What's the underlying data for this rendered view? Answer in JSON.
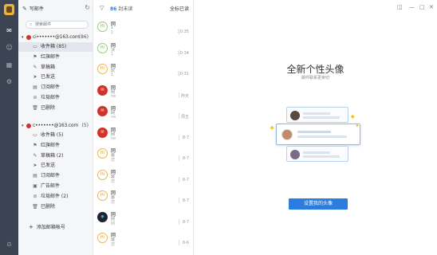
{
  "app": {
    "compose_label": "写邮件",
    "search_placeholder": "搜索邮件"
  },
  "accounts": [
    {
      "name": "ci•••••••@163.com",
      "count": "(86)",
      "folders": [
        {
          "label": "收件箱 (85)",
          "icon": "inbox-icon",
          "glyph": "▭",
          "selected": true
        },
        {
          "label": "红旗邮件",
          "icon": "flag-icon",
          "glyph": "⚑"
        },
        {
          "label": "草稿箱",
          "icon": "draft-icon",
          "glyph": "✎"
        },
        {
          "label": "已发送",
          "icon": "sent-icon",
          "glyph": "➤"
        },
        {
          "label": "订阅邮件",
          "icon": "subscription-icon",
          "glyph": "▤"
        },
        {
          "label": "垃圾邮件",
          "icon": "spam-icon",
          "glyph": "⊘"
        },
        {
          "label": "已删除",
          "icon": "trash-icon",
          "glyph": "🗑"
        }
      ]
    },
    {
      "name": "c•••••••@163.com",
      "count": "(5)",
      "folders": [
        {
          "label": "收件箱 (5)",
          "icon": "inbox-icon",
          "glyph": "▭"
        },
        {
          "label": "红旗邮件",
          "icon": "flag-icon",
          "glyph": "⚑"
        },
        {
          "label": "草稿箱 (2)",
          "icon": "draft-icon",
          "glyph": "✎"
        },
        {
          "label": "已发送",
          "icon": "sent-icon",
          "glyph": "➤"
        },
        {
          "label": "订阅邮件",
          "icon": "subscription-icon",
          "glyph": "▤"
        },
        {
          "label": "广告邮件",
          "icon": "ad-icon",
          "glyph": "▣"
        },
        {
          "label": "垃圾邮件 (2)",
          "icon": "spam-icon",
          "glyph": "⊘"
        },
        {
          "label": "已删除",
          "icon": "trash-icon",
          "glyph": "🗑"
        }
      ]
    }
  ],
  "add_account_label": "添加邮箱帐号",
  "list": {
    "unread_count": "86",
    "unread_label": "封未读",
    "mark_all_label": "全标已读",
    "messages": [
      {
        "avatar": "Hi",
        "style": "g",
        "line1": "网",
        "line2": "1",
        "line3": "1",
        "time": "10:35"
      },
      {
        "avatar": "Hi",
        "style": "g",
        "line1": "网",
        "line2": "决",
        "line3": "1",
        "time": "10:34"
      },
      {
        "avatar": "Hi",
        "style": "y",
        "line1": "网",
        "line2": "欢",
        "line3": "1",
        "time": "10:31"
      },
      {
        "avatar": "✉",
        "style": "r",
        "line1": "网",
        "line2": "网",
        "line3": "ne",
        "time": "昨天"
      },
      {
        "avatar": "✉",
        "style": "r",
        "line1": "网",
        "line2": "网",
        "line3": "ne",
        "time": "周五"
      },
      {
        "avatar": "✉",
        "style": "r",
        "line1": "网",
        "line2": "网",
        "line3": "ne",
        "time": "8-7"
      },
      {
        "avatar": "Hi",
        "style": "y",
        "line1": "网",
        "line2": "最",
        "line3": "您",
        "time": "8-7"
      },
      {
        "avatar": "Hi",
        "style": "y",
        "line1": "网",
        "line2": "最",
        "line3": "您",
        "time": "8-7"
      },
      {
        "avatar": "Hi",
        "style": "y",
        "line1": "网",
        "line2": "最",
        "line3": "您",
        "time": "8-7"
      },
      {
        "avatar": "◉",
        "style": "k",
        "line1": "网",
        "line2": "网",
        "line3": "网",
        "time": "8-7"
      },
      {
        "avatar": "Hi",
        "style": "y",
        "line1": "网",
        "line2": "最",
        "line3": "您",
        "time": "8-6"
      }
    ]
  },
  "promo": {
    "title": "全新个性头像",
    "subtitle": "邮件联系更亲切",
    "button_label": "设置我的头像"
  }
}
